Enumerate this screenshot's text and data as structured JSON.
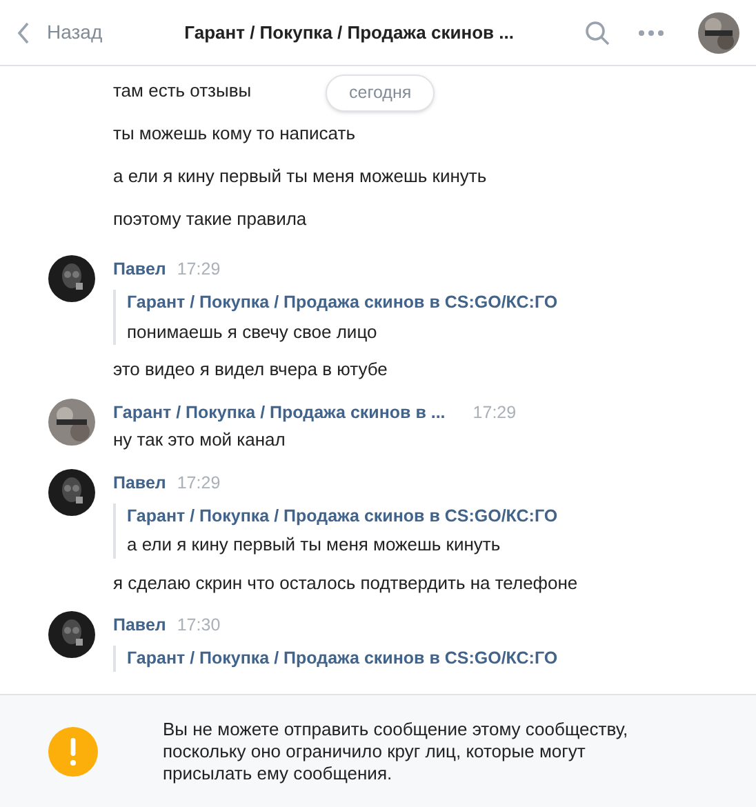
{
  "header": {
    "back_label": "Назад",
    "title": "Гарант / Покупка / Продажа скинов ..."
  },
  "date_badge": "сегодня",
  "feed": [
    {
      "kind": "line",
      "text": "там есть отзывы"
    },
    {
      "kind": "line",
      "text": "ты можешь кому то написать"
    },
    {
      "kind": "line",
      "text": "а ели я кину первый ты меня можешь кинуть"
    },
    {
      "kind": "line",
      "text": "поэтому такие правила"
    },
    {
      "kind": "post",
      "avatar": {
        "kind": "person"
      },
      "author": "Павел",
      "time": "17:29",
      "forwarded": {
        "source": "Гарант / Покупка / Продажа скинов в CS:GO/КС:ГО",
        "text": "понимаешь я свечу свое лицо"
      },
      "lines": [
        "это видео я видел вчера в ютубе"
      ]
    },
    {
      "kind": "post",
      "avatar": {
        "kind": "community"
      },
      "author": "Гарант / Покупка / Продажа скинов в ...",
      "time": "17:29",
      "lines": [
        "ну так это мой канал"
      ]
    },
    {
      "kind": "post",
      "avatar": {
        "kind": "person"
      },
      "author": "Павел",
      "time": "17:29",
      "forwarded": {
        "source": "Гарант / Покупка / Продажа скинов в CS:GO/КС:ГО",
        "text": "а ели я кину первый ты меня можешь кинуть"
      },
      "lines": [
        "я сделаю скрин что осталось подтвердить на телефоне"
      ]
    },
    {
      "kind": "post",
      "avatar": {
        "kind": "person"
      },
      "author": "Павел",
      "time": "17:30",
      "forwarded": {
        "source": "Гарант / Покупка / Продажа скинов в CS:GO/КС:ГО"
      }
    }
  ],
  "notice": {
    "text": "Вы не можете отправить сообщение этому сообществу, поскольку оно ограничило круг лиц, которые могут присылать ему сообщения."
  }
}
